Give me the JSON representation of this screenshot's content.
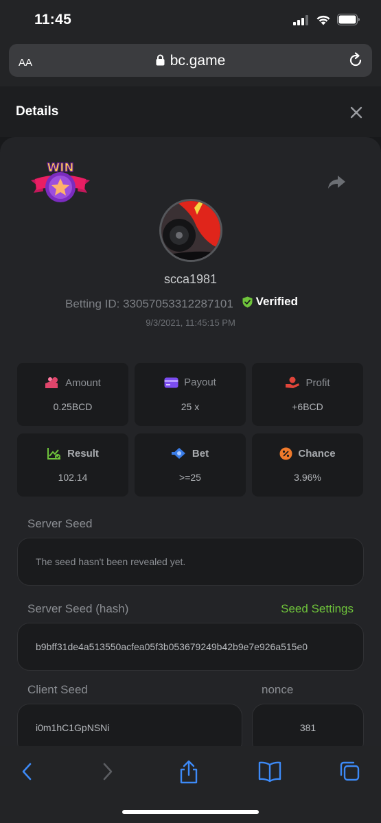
{
  "status_bar": {
    "time": "11:45"
  },
  "browser": {
    "text_size_label": "AA",
    "url": "bc.game"
  },
  "panel": {
    "title": "Details"
  },
  "bet": {
    "badge": "WIN",
    "username": "scca1981",
    "betting_id_label": "Betting ID: 33057053312287101",
    "verified_label": "Verified",
    "timestamp": "9/3/2021, 11:45:15 PM"
  },
  "stats": [
    {
      "label": "Amount",
      "value": "0.25BCD",
      "icon": "coins-icon",
      "color": "#e0456b"
    },
    {
      "label": "Payout",
      "value": "25 x",
      "icon": "card-icon",
      "color": "#7b4cf0"
    },
    {
      "label": "Profit",
      "value": "+6BCD",
      "icon": "hand-coin-icon",
      "color": "#e0453a"
    },
    {
      "label": "Result",
      "value": "102.14",
      "icon": "chart-check-icon",
      "color": "#6fc43b"
    },
    {
      "label": "Bet",
      "value": ">=25",
      "icon": "ticket-icon",
      "color": "#3a7de8"
    },
    {
      "label": "Chance",
      "value": "3.96%",
      "icon": "percent-icon",
      "color": "#f07a2b"
    }
  ],
  "server_seed": {
    "label": "Server Seed",
    "value": "The seed hasn't been revealed yet."
  },
  "server_seed_hash": {
    "label": "Server Seed (hash)",
    "link": "Seed Settings",
    "value": "b9bff31de4a513550acfea05f3b053679249b42b9e7e926a515e0"
  },
  "client_seed": {
    "label": "Client Seed",
    "value": "i0m1hC1GpNSNi"
  },
  "nonce": {
    "label": "nonce",
    "value": "381"
  },
  "colors": {
    "accent_green": "#6fc43b",
    "safari_blue": "#3d8af7"
  }
}
